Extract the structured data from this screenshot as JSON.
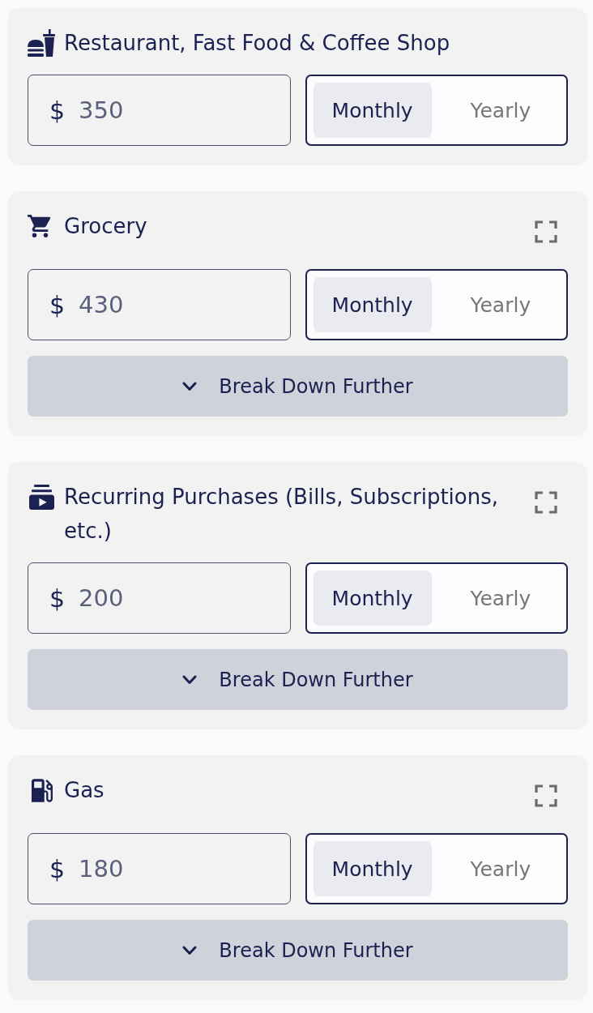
{
  "categories": [
    {
      "kind": "restaurant",
      "title": "Restaurant, Fast Food & Coffee Shop",
      "expandable": false,
      "amount": {
        "currency": "$",
        "value": "350"
      },
      "period_options": [
        {
          "label": "Monthly",
          "selected": true
        },
        {
          "label": "Yearly",
          "selected": false
        }
      ]
    },
    {
      "kind": "grocery",
      "title": "Grocery",
      "expandable": true,
      "amount": {
        "currency": "$",
        "value": "430"
      },
      "period_options": [
        {
          "label": "Monthly",
          "selected": true
        },
        {
          "label": "Yearly",
          "selected": false
        }
      ],
      "breakdown_button": {
        "label": "Break Down Further"
      }
    },
    {
      "kind": "recurring",
      "title": "Recurring Purchases (Bills, Subscriptions, etc.)",
      "expandable": true,
      "amount": {
        "currency": "$",
        "value": "200"
      },
      "period_options": [
        {
          "label": "Monthly",
          "selected": true
        },
        {
          "label": "Yearly",
          "selected": false
        }
      ],
      "breakdown_button": {
        "label": "Break Down Further"
      }
    },
    {
      "kind": "gas",
      "title": "Gas",
      "expandable": true,
      "amount": {
        "currency": "$",
        "value": "180"
      },
      "period_options": [
        {
          "label": "Monthly",
          "selected": true
        },
        {
          "label": "Yearly",
          "selected": false
        }
      ],
      "breakdown_button": {
        "label": "Break Down Further"
      }
    }
  ]
}
